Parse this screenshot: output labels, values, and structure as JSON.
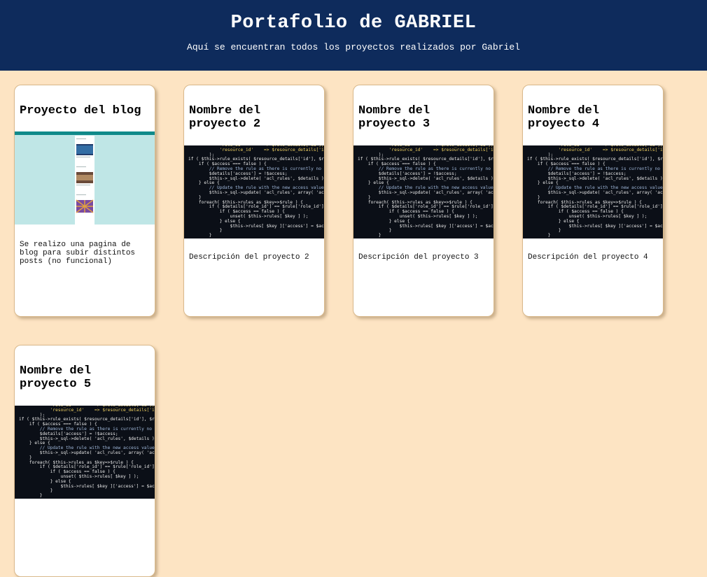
{
  "header": {
    "title": "Portafolio de GABRIEL",
    "subtitle": "Aquí se encuentran todos los proyectos realizados por Gabriel"
  },
  "colors": {
    "header_bg": "#0e2b5c",
    "page_bg": "#fde4c3",
    "card_bg": "#ffffff"
  },
  "projects": [
    {
      "title": "Proyecto del blog",
      "description": "Se realizo una pagina de blog para subir distintos posts (no funcional)",
      "thumbnail": "blog-screenshot"
    },
    {
      "title": "Nombre del proyecto 2",
      "description": "Descripción del proyecto 2",
      "thumbnail": "code-screenshot"
    },
    {
      "title": "Nombre del proyecto 3",
      "description": "Descripción del proyecto 3",
      "thumbnail": "code-screenshot"
    },
    {
      "title": "Nombre del proyecto 4",
      "description": "Descripción del proyecto 4",
      "thumbnail": "code-screenshot"
    },
    {
      "title": "Nombre del proyecto 5",
      "description": "",
      "thumbnail": "code-screenshot"
    }
  ]
}
